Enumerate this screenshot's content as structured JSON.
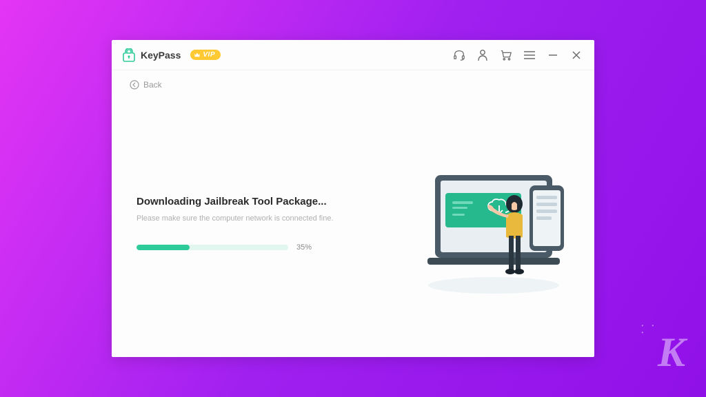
{
  "app": {
    "title": "KeyPass",
    "vip_label": "VIP"
  },
  "back_label": "Back",
  "main": {
    "heading": "Downloading Jailbreak Tool Package...",
    "subtext": "Please make sure the computer network is connected fine.",
    "progress_percent": 35,
    "progress_label": "35%"
  },
  "colors": {
    "accent": "#2ecb9a",
    "vip": "#ffc933"
  },
  "watermark_letter": "K"
}
